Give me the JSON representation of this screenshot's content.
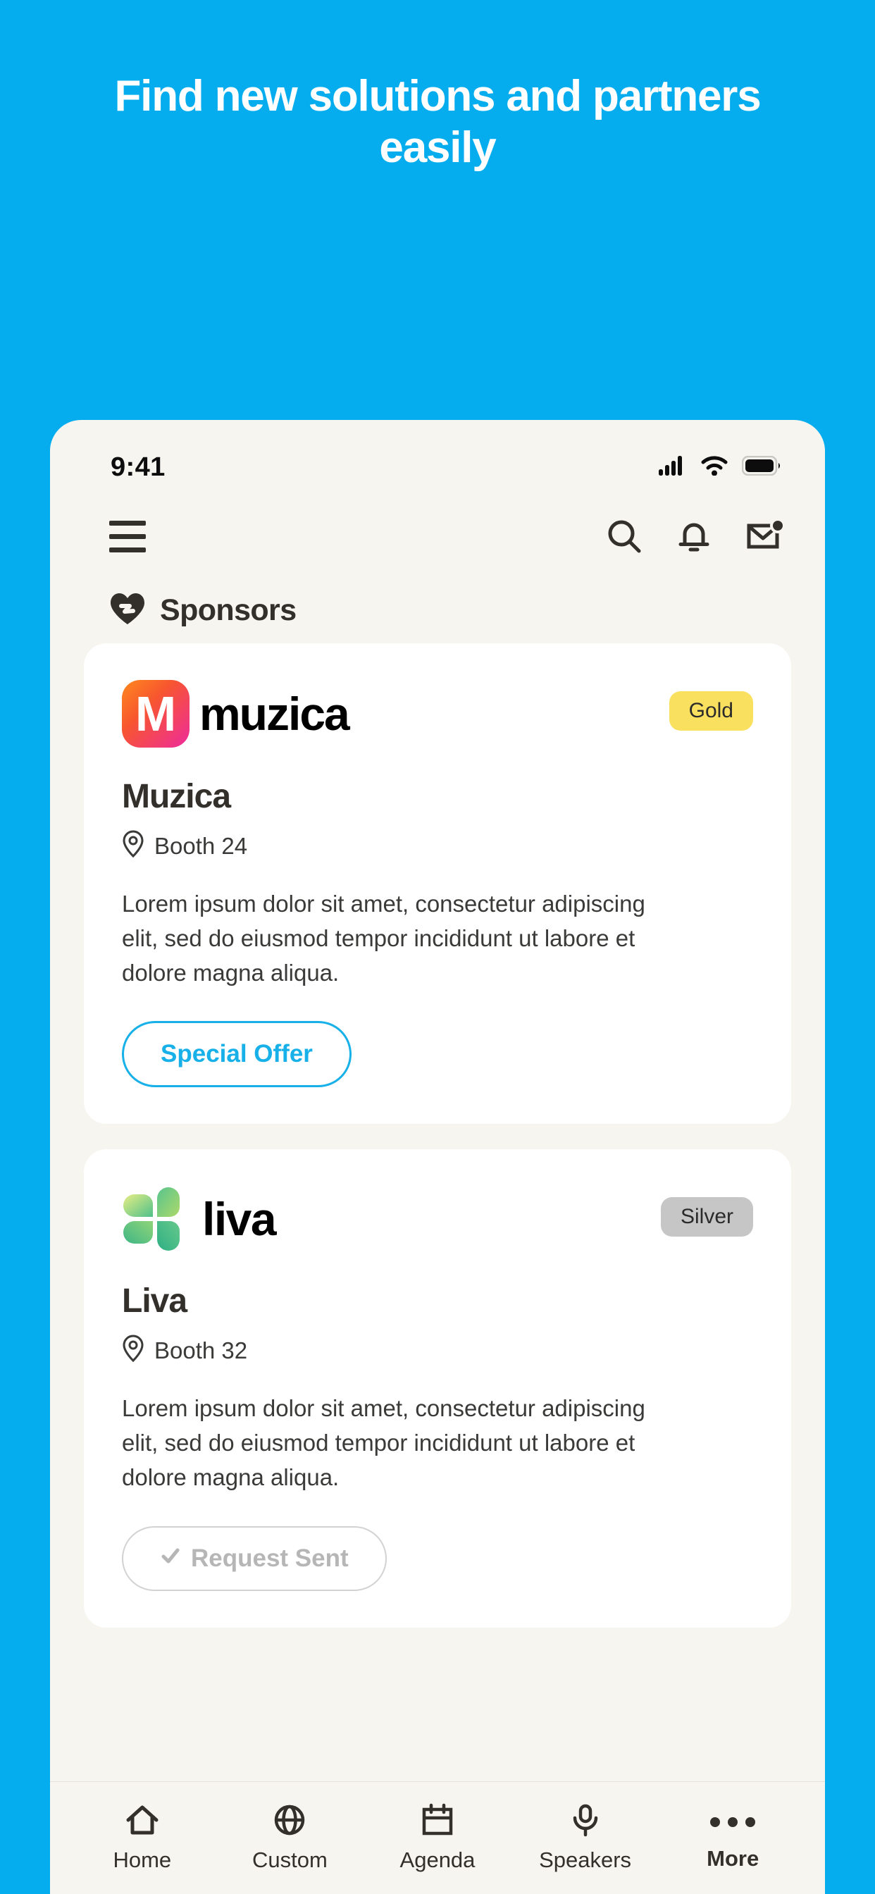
{
  "headline": "Find new solutions and partners easily",
  "theme": {
    "brand_blue": "#05ADEE",
    "accent_blue": "#17B0E8",
    "phone_bg": "#F7F5F0",
    "card_bg": "#FFFFFF",
    "text_dark": "#33302C"
  },
  "statusbar": {
    "time": "9:41",
    "icons": [
      "cellular-signal-icon",
      "wifi-icon",
      "battery-icon"
    ]
  },
  "header": {
    "menu_icon": "hamburger-menu-icon",
    "actions": [
      {
        "name": "search-icon",
        "label": "Search"
      },
      {
        "name": "notifications-bell-icon",
        "label": "Notifications"
      },
      {
        "name": "mail-icon",
        "label": "Messages",
        "badge": true
      }
    ]
  },
  "section": {
    "icon": "sponsors-heart-icon",
    "title": "Sponsors"
  },
  "sponsors": [
    {
      "logo_type": "muzica-logo",
      "wordmark": "muzica",
      "logo_glyph": "M",
      "badge": "Gold",
      "badge_tier": "gold",
      "name": "Muzica",
      "booth": "Booth 24",
      "booth_icon": "location-pin-icon",
      "description": "Lorem ipsum dolor sit amet, consectetur adipiscing elit, sed do eiusmod tempor incididunt ut labore et dolore magna aliqua.",
      "action_label": "Special Offer",
      "action_state": "active"
    },
    {
      "logo_type": "liva-logo",
      "wordmark": "liva",
      "badge": "Silver",
      "badge_tier": "silver",
      "name": "Liva",
      "booth": "Booth 32",
      "booth_icon": "location-pin-icon",
      "description": "Lorem ipsum dolor sit amet, consectetur adipiscing elit, sed do eiusmod tempor incididunt ut labore et dolore magna aliqua.",
      "action_label": "Request Sent",
      "action_state": "disabled"
    }
  ],
  "bottomnav": [
    {
      "icon": "home-icon",
      "label": "Home",
      "active": false
    },
    {
      "icon": "globe-icon",
      "label": "Custom",
      "active": false
    },
    {
      "icon": "calendar-icon",
      "label": "Agenda",
      "active": false
    },
    {
      "icon": "microphone-icon",
      "label": "Speakers",
      "active": false
    },
    {
      "icon": "more-dots-icon",
      "label": "More",
      "active": true
    }
  ]
}
